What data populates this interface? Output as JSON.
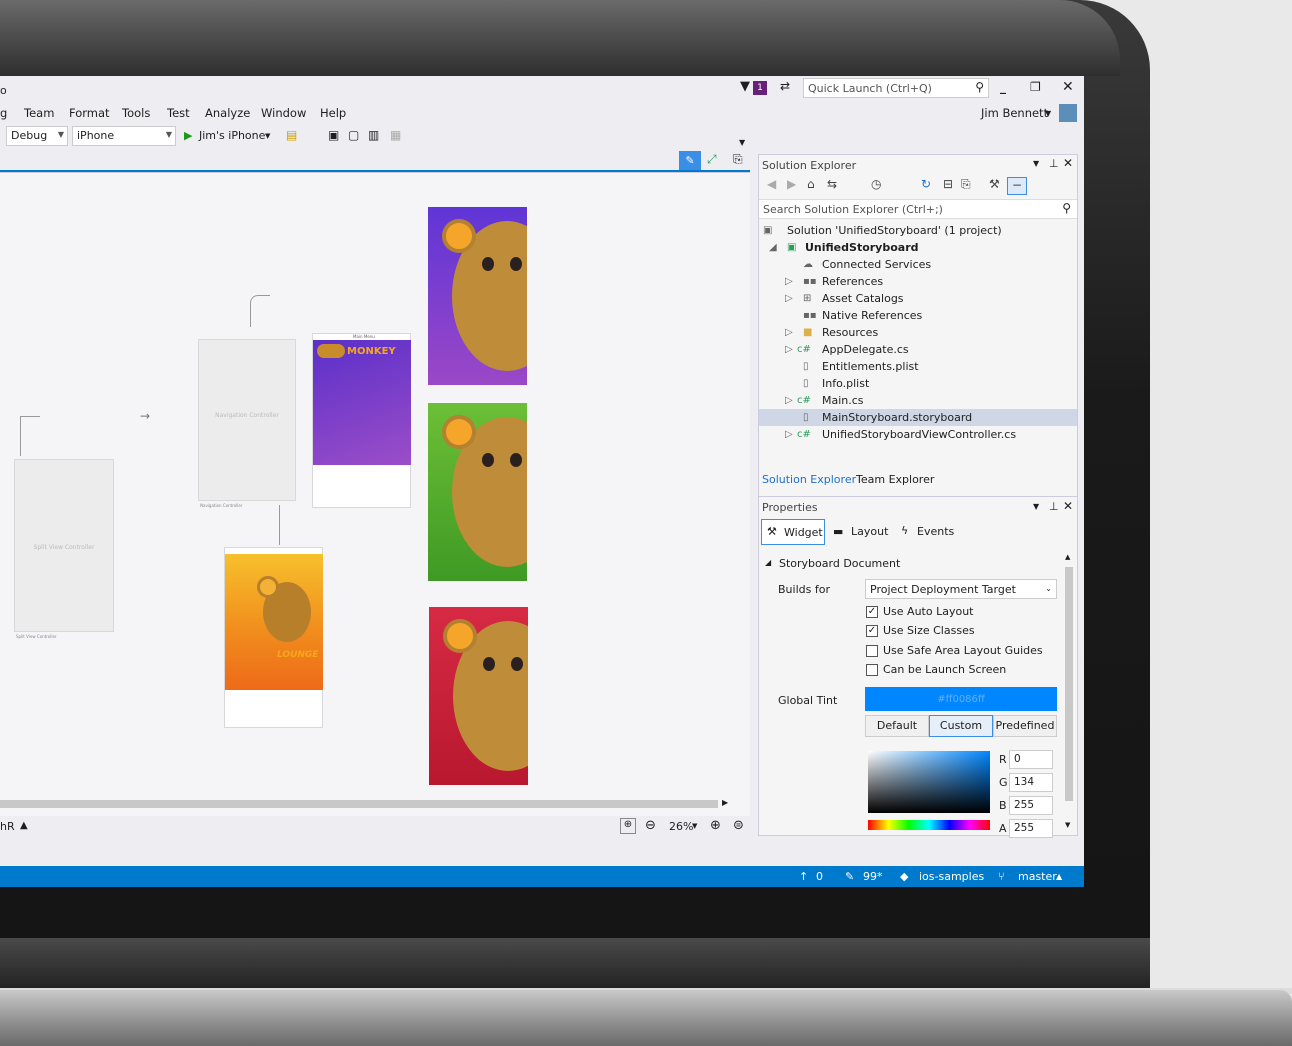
{
  "title": {
    "app_fragment": "o"
  },
  "menu": [
    "g",
    "Team",
    "Format",
    "Tools",
    "Test",
    "Analyze",
    "Window",
    "Help"
  ],
  "toolbar": {
    "config": "Debug",
    "platform": "iPhone",
    "run_target": "Jim's iPhone"
  },
  "quick_launch": {
    "placeholder": "Quick Launch (Ctrl+Q)",
    "notification_count": "1"
  },
  "user": {
    "name": "Jim Bennett"
  },
  "designer": {
    "scenes": {
      "split": "Split View Controller",
      "split_footer": "Split View Controller",
      "nav": "Navigation Controller",
      "nav_footer": "Navigation Controller",
      "main_title": "Main Menu",
      "main_logo": "MONKEY",
      "orange_logo": "LOUNGE"
    },
    "bottom_left": "hR",
    "zoom": "26%"
  },
  "solution_explorer": {
    "title": "Solution Explorer",
    "search_placeholder": "Search Solution Explorer (Ctrl+;)",
    "tree": [
      {
        "label": "Solution 'UnifiedStoryboard' (1 project)"
      },
      {
        "label": "UnifiedStoryboard"
      },
      {
        "label": "Connected Services"
      },
      {
        "label": "References"
      },
      {
        "label": "Asset Catalogs"
      },
      {
        "label": "Native References"
      },
      {
        "label": "Resources"
      },
      {
        "label": "AppDelegate.cs"
      },
      {
        "label": "Entitlements.plist"
      },
      {
        "label": "Info.plist"
      },
      {
        "label": "Main.cs"
      },
      {
        "label": "MainStoryboard.storyboard"
      },
      {
        "label": "UnifiedStoryboardViewController.cs"
      }
    ],
    "tabs": [
      "Solution Explorer",
      "Team Explorer"
    ]
  },
  "properties": {
    "title": "Properties",
    "tabs": [
      "Widget",
      "Layout",
      "Events"
    ],
    "section": "Storyboard Document",
    "builds_for_label": "Builds for",
    "builds_for_value": "Project Deployment Target",
    "checks": [
      {
        "label": "Use Auto Layout",
        "checked": true
      },
      {
        "label": "Use Size Classes",
        "checked": true
      },
      {
        "label": "Use Safe Area Layout Guides",
        "checked": false
      },
      {
        "label": "Can be Launch Screen",
        "checked": false
      }
    ],
    "global_tint_label": "Global Tint",
    "global_tint_value": "#ff0086ff",
    "tint_buttons": [
      "Default",
      "Custom",
      "Predefined"
    ],
    "rgba": [
      {
        "channel": "R",
        "value": "0"
      },
      {
        "channel": "G",
        "value": "134"
      },
      {
        "channel": "B",
        "value": "255"
      },
      {
        "channel": "A",
        "value": "255"
      }
    ],
    "tint_color": "#0086ff"
  },
  "status": {
    "up": "0",
    "edits": "99*",
    "repo": "ios-samples",
    "branch": "master"
  },
  "colors": {
    "accent": "#007acc",
    "purple": "#7b3fd0",
    "green": "#5aac2e",
    "red": "#c2203b",
    "orange": "#f08a1c"
  }
}
